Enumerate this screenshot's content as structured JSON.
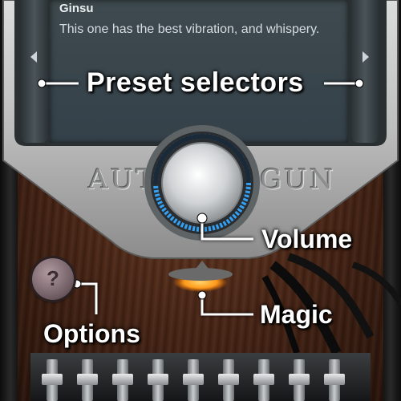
{
  "preset": {
    "name": "Ginsu",
    "description": "This one has the best vibration, and whispery."
  },
  "callouts": {
    "preset_selectors": "Preset selectors",
    "volume": "Volume",
    "magic": "Magic",
    "options": "Options"
  },
  "brand": {
    "left": "AUT",
    "right": "GUN"
  },
  "options_button": {
    "glyph": "?"
  },
  "icons": {
    "prev": "chevron-left-icon",
    "next": "chevron-right-icon",
    "options": "question-icon"
  },
  "colors": {
    "volume_ring": "#35a6ff",
    "magic_glow": "#ff9a1a",
    "screen": "#3b474c",
    "callout_text": "#ffffff"
  }
}
